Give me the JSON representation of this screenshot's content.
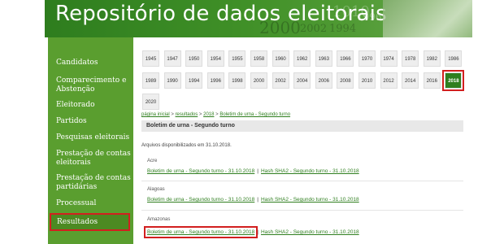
{
  "banner": {
    "title": "Repositório de dados eleitorais"
  },
  "sidebar": {
    "items": [
      {
        "label": "Candidatos"
      },
      {
        "label": "Comparecimento e Abstenção"
      },
      {
        "label": "Eleitorado"
      },
      {
        "label": "Partidos"
      },
      {
        "label": "Pesquisas eleitorais"
      },
      {
        "label": "Prestação de contas eleitorais"
      },
      {
        "label": "Prestação de contas partidárias"
      },
      {
        "label": "Processual"
      },
      {
        "label": "Resultados"
      }
    ]
  },
  "years": {
    "row1": [
      "1945",
      "1947",
      "1950",
      "1954",
      "1955",
      "1958",
      "1960",
      "1962",
      "1963",
      "1966",
      "1970",
      "1974",
      "1978",
      "1982",
      "1986"
    ],
    "row2": [
      "1989",
      "1990",
      "1994",
      "1996",
      "1998",
      "2000",
      "2002",
      "2004",
      "2006",
      "2008",
      "2010",
      "2012",
      "2014",
      "2016",
      "2018"
    ],
    "row3": [
      "2020"
    ],
    "selected": "2018"
  },
  "breadcrumb": {
    "items": [
      "página inicial",
      "resultados",
      "2018",
      "Boletim de urna - Segundo turno"
    ],
    "separator": ">"
  },
  "section": {
    "title": "Boletim de urna - Segundo turno"
  },
  "available_text": "Arquivos disponibilizados em 31.10.2018.",
  "states": [
    {
      "name": "Acre",
      "link1": "Boletim de urna - Segundo turno - 31.10.2018",
      "link2": "Hash SHA2 - Segundo turno - 31.10.2018"
    },
    {
      "name": "Alagoas",
      "link1": "Boletim de urna - Segundo turno - 31.10.2018",
      "link2": "Hash SHA2 - Segundo turno - 31.10.2018"
    },
    {
      "name": "Amazonas",
      "link1": "Boletim de urna - Segundo turno - 31.10.2018",
      "link2": "Hash SHA2 - Segundo turno - 31.10.2018"
    }
  ],
  "link_separator": "|"
}
